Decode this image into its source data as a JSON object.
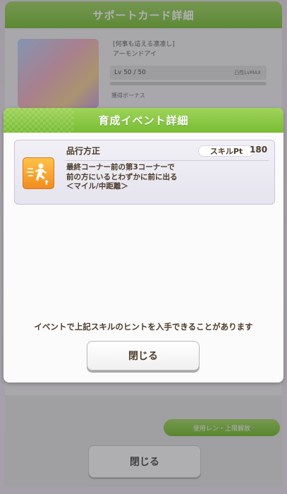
{
  "background": {
    "header_title": "サポートカード詳細",
    "card_title_line1": "[何事も這える凛凛し]",
    "card_title_line2": "アーモンドアイ",
    "level_text": "Lv 50 / 50",
    "level_max_text": "凸性LvMAX",
    "subtitle": "獲得ボーナス",
    "green_button_label": "使用レン・上限解放",
    "close_button_label": "閉じる"
  },
  "dialog": {
    "title": "育成イベント詳細",
    "skill": {
      "name": "品行方正",
      "icon": "running-speed-up-icon",
      "pt_label": "スキルPt",
      "pt_value": "180",
      "description": [
        "最終コーナー前の第3コーナーで",
        "前の方にいるとわずかに前に出る",
        "＜マイル/中距離＞"
      ]
    },
    "note": "イベントで上記スキルのヒントを入手できることがあります",
    "close_label": "閉じる"
  },
  "colors": {
    "header_green": "#8cc84b",
    "text_brown": "#4d3b2a",
    "icon_orange": "#f7a533"
  }
}
